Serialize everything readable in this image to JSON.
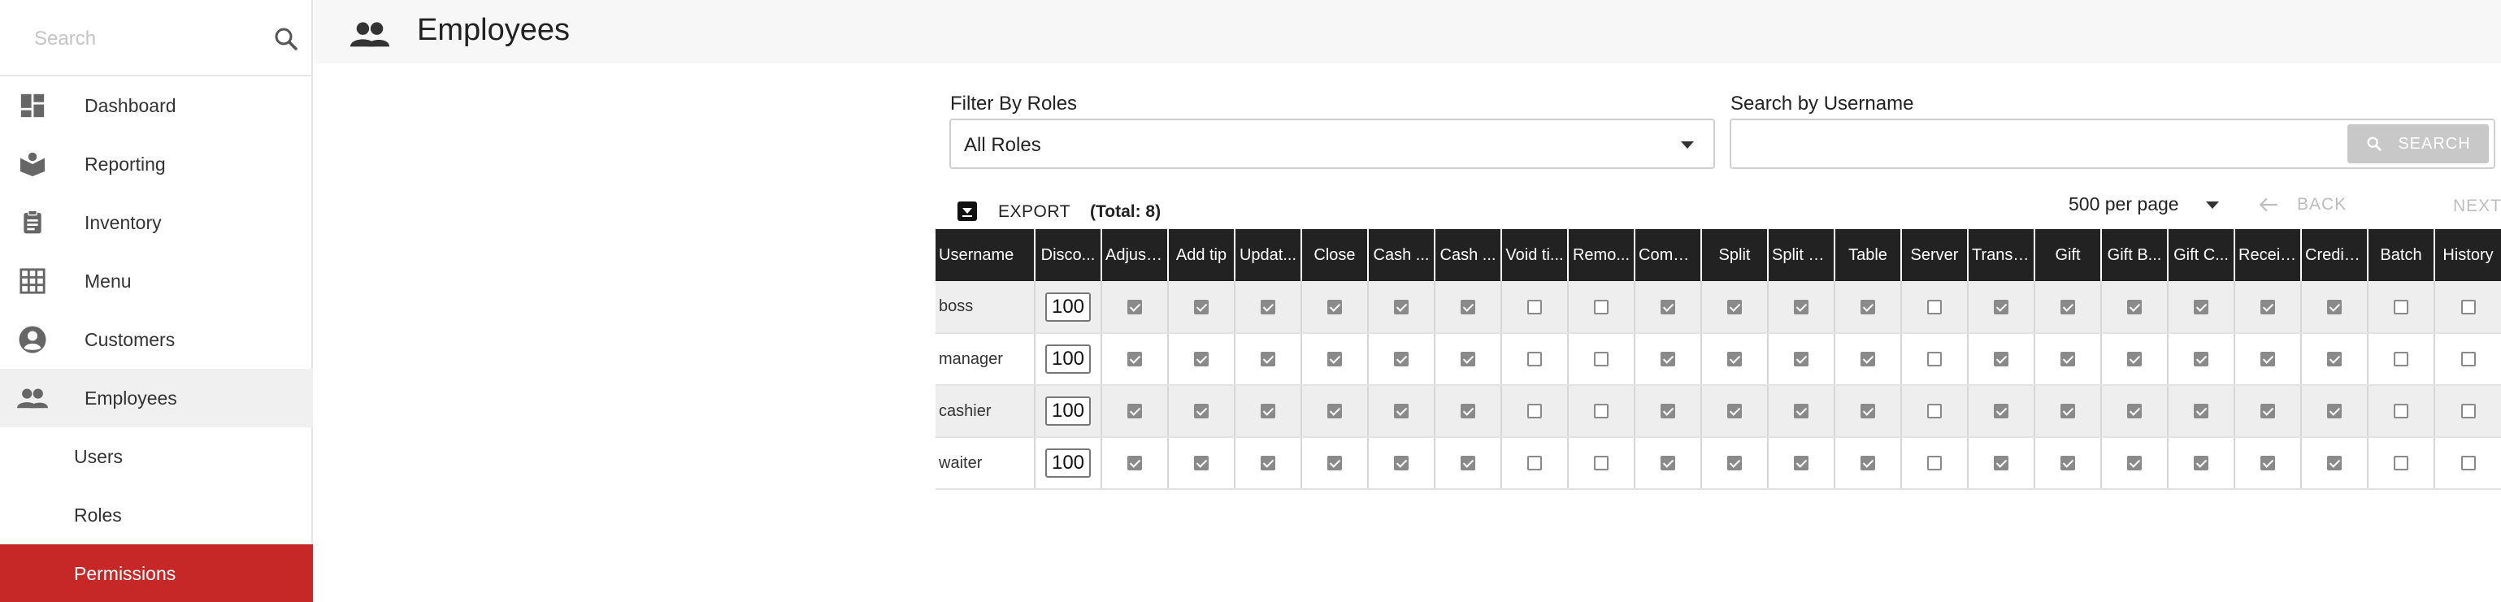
{
  "sidebar": {
    "search_placeholder": "Search",
    "items": [
      {
        "label": "Dashboard",
        "icon": "dashboard-icon"
      },
      {
        "label": "Reporting",
        "icon": "reporting-icon"
      },
      {
        "label": "Inventory",
        "icon": "clipboard-icon"
      },
      {
        "label": "Menu",
        "icon": "grid-icon"
      },
      {
        "label": "Customers",
        "icon": "account-circle-icon"
      },
      {
        "label": "Employees",
        "icon": "people-icon"
      }
    ],
    "sub_items": [
      {
        "label": "Users"
      },
      {
        "label": "Roles"
      },
      {
        "label": "Permissions"
      }
    ],
    "active_color": "#c62828"
  },
  "header": {
    "title": "Employees",
    "icon": "people-icon"
  },
  "filters": {
    "roles_label": "Filter By Roles",
    "roles_value": "All Roles",
    "username_label": "Search by Username",
    "username_value": "",
    "search_button": "SEARCH"
  },
  "toolbar": {
    "export_label": "EXPORT",
    "total_label": "(Total: 8)",
    "per_page": "500 per page",
    "back_label": "BACK",
    "next_label": "NEXT"
  },
  "table": {
    "columns": [
      "Username",
      "Disco...",
      "Adjust...",
      "Add tip",
      "Updat...",
      "Close",
      "Cash ...",
      "Cash ...",
      "Void ti...",
      "Remo...",
      "Combi...",
      "Split",
      "Split out",
      "Table",
      "Server",
      "Transf...",
      "Gift",
      "Gift B...",
      "Gift C...",
      "Receip...",
      "Credit ...",
      "Batch",
      "History"
    ],
    "rows": [
      {
        "username": "boss",
        "discount": "100",
        "perms": [
          true,
          true,
          true,
          true,
          true,
          true,
          false,
          false,
          true,
          true,
          true,
          true,
          false,
          true,
          true,
          true,
          true,
          true,
          true,
          false,
          false
        ]
      },
      {
        "username": "manager",
        "discount": "100",
        "perms": [
          true,
          true,
          true,
          true,
          true,
          true,
          false,
          false,
          true,
          true,
          true,
          true,
          false,
          true,
          true,
          true,
          true,
          true,
          true,
          false,
          false
        ]
      },
      {
        "username": "cashier",
        "discount": "100",
        "perms": [
          true,
          true,
          true,
          true,
          true,
          true,
          false,
          false,
          true,
          true,
          true,
          true,
          false,
          true,
          true,
          true,
          true,
          true,
          true,
          false,
          false
        ]
      },
      {
        "username": "waiter",
        "discount": "100",
        "perms": [
          true,
          true,
          true,
          true,
          true,
          true,
          false,
          false,
          true,
          true,
          true,
          true,
          false,
          true,
          true,
          true,
          true,
          true,
          true,
          false,
          false
        ]
      }
    ]
  }
}
